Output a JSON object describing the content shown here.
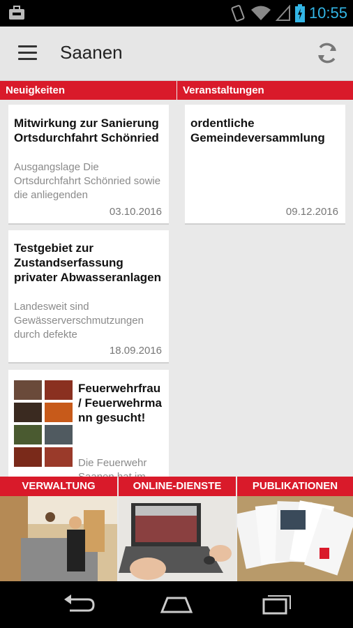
{
  "status_bar": {
    "time": "10:55"
  },
  "app_bar": {
    "title": "Saanen",
    "menu_icon": "menu-icon",
    "refresh_icon": "refresh-icon"
  },
  "columns": {
    "news_header": "Neuigkeiten",
    "events_header": "Veranstaltungen"
  },
  "news": [
    {
      "title": "Mitwirkung zur Sanierung Ortsdurchfahrt Schönried",
      "excerpt": "Ausgangslage Die Ortsdurchfahrt Schönried sowie die anliegenden",
      "date": "03.10.2016"
    },
    {
      "title": "Testgebiet zur Zustandserfassung privater Abwasseranlagen",
      "excerpt": "Landesweit sind Gewässerverschmutzungen durch defekte",
      "date": "18.09.2016"
    },
    {
      "title": "Feuerwehrfrau / Feuerwehrmann gesucht!",
      "excerpt": "Die Feuerwehr Saanen hat im"
    }
  ],
  "events": [
    {
      "title": "ordentliche Gemeindeversammlung",
      "date": "09.12.2016"
    }
  ],
  "tiles": [
    {
      "label": "VERWALTUNG"
    },
    {
      "label": "ONLINE-DIENSTE"
    },
    {
      "label": "PUBLIKATIONEN"
    }
  ],
  "colors": {
    "accent": "#d91a2a",
    "status_time": "#33b5e5"
  }
}
